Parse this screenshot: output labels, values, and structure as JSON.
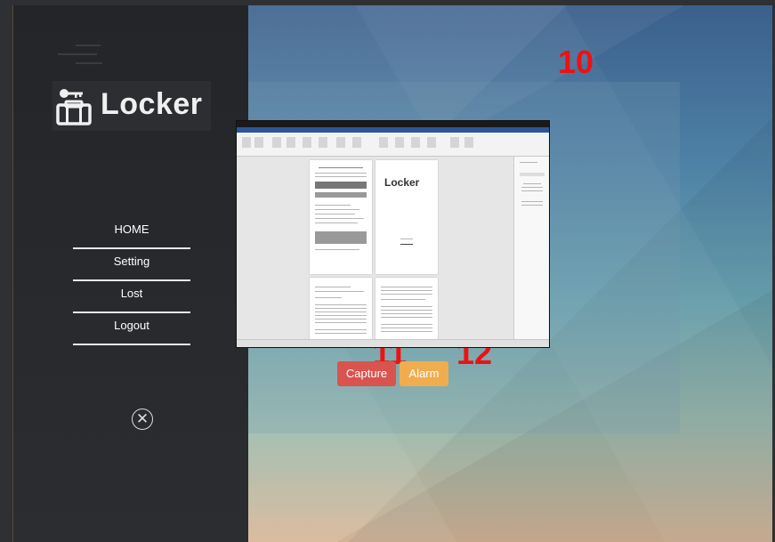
{
  "sidebar": {
    "logo_text": "Locker",
    "nav": [
      {
        "label": "HOME"
      },
      {
        "label": "Setting"
      },
      {
        "label": "Lost"
      },
      {
        "label": "Logout"
      }
    ]
  },
  "main": {
    "annotations": {
      "n10": "10",
      "n11": "11",
      "n12": "12"
    },
    "preview": {
      "inner_logo_text": "Locker"
    },
    "buttons": {
      "capture_label": "Capture",
      "alarm_label": "Alarm"
    }
  },
  "colors": {
    "capture": "#d9534f",
    "alarm": "#f0ad4e",
    "annotation": "#ee1111",
    "sidebar_bg": "#232528"
  },
  "icons": {
    "menu": "hamburger-icon",
    "logo": "briefcase-key-icon",
    "close": "close-circle-icon"
  }
}
